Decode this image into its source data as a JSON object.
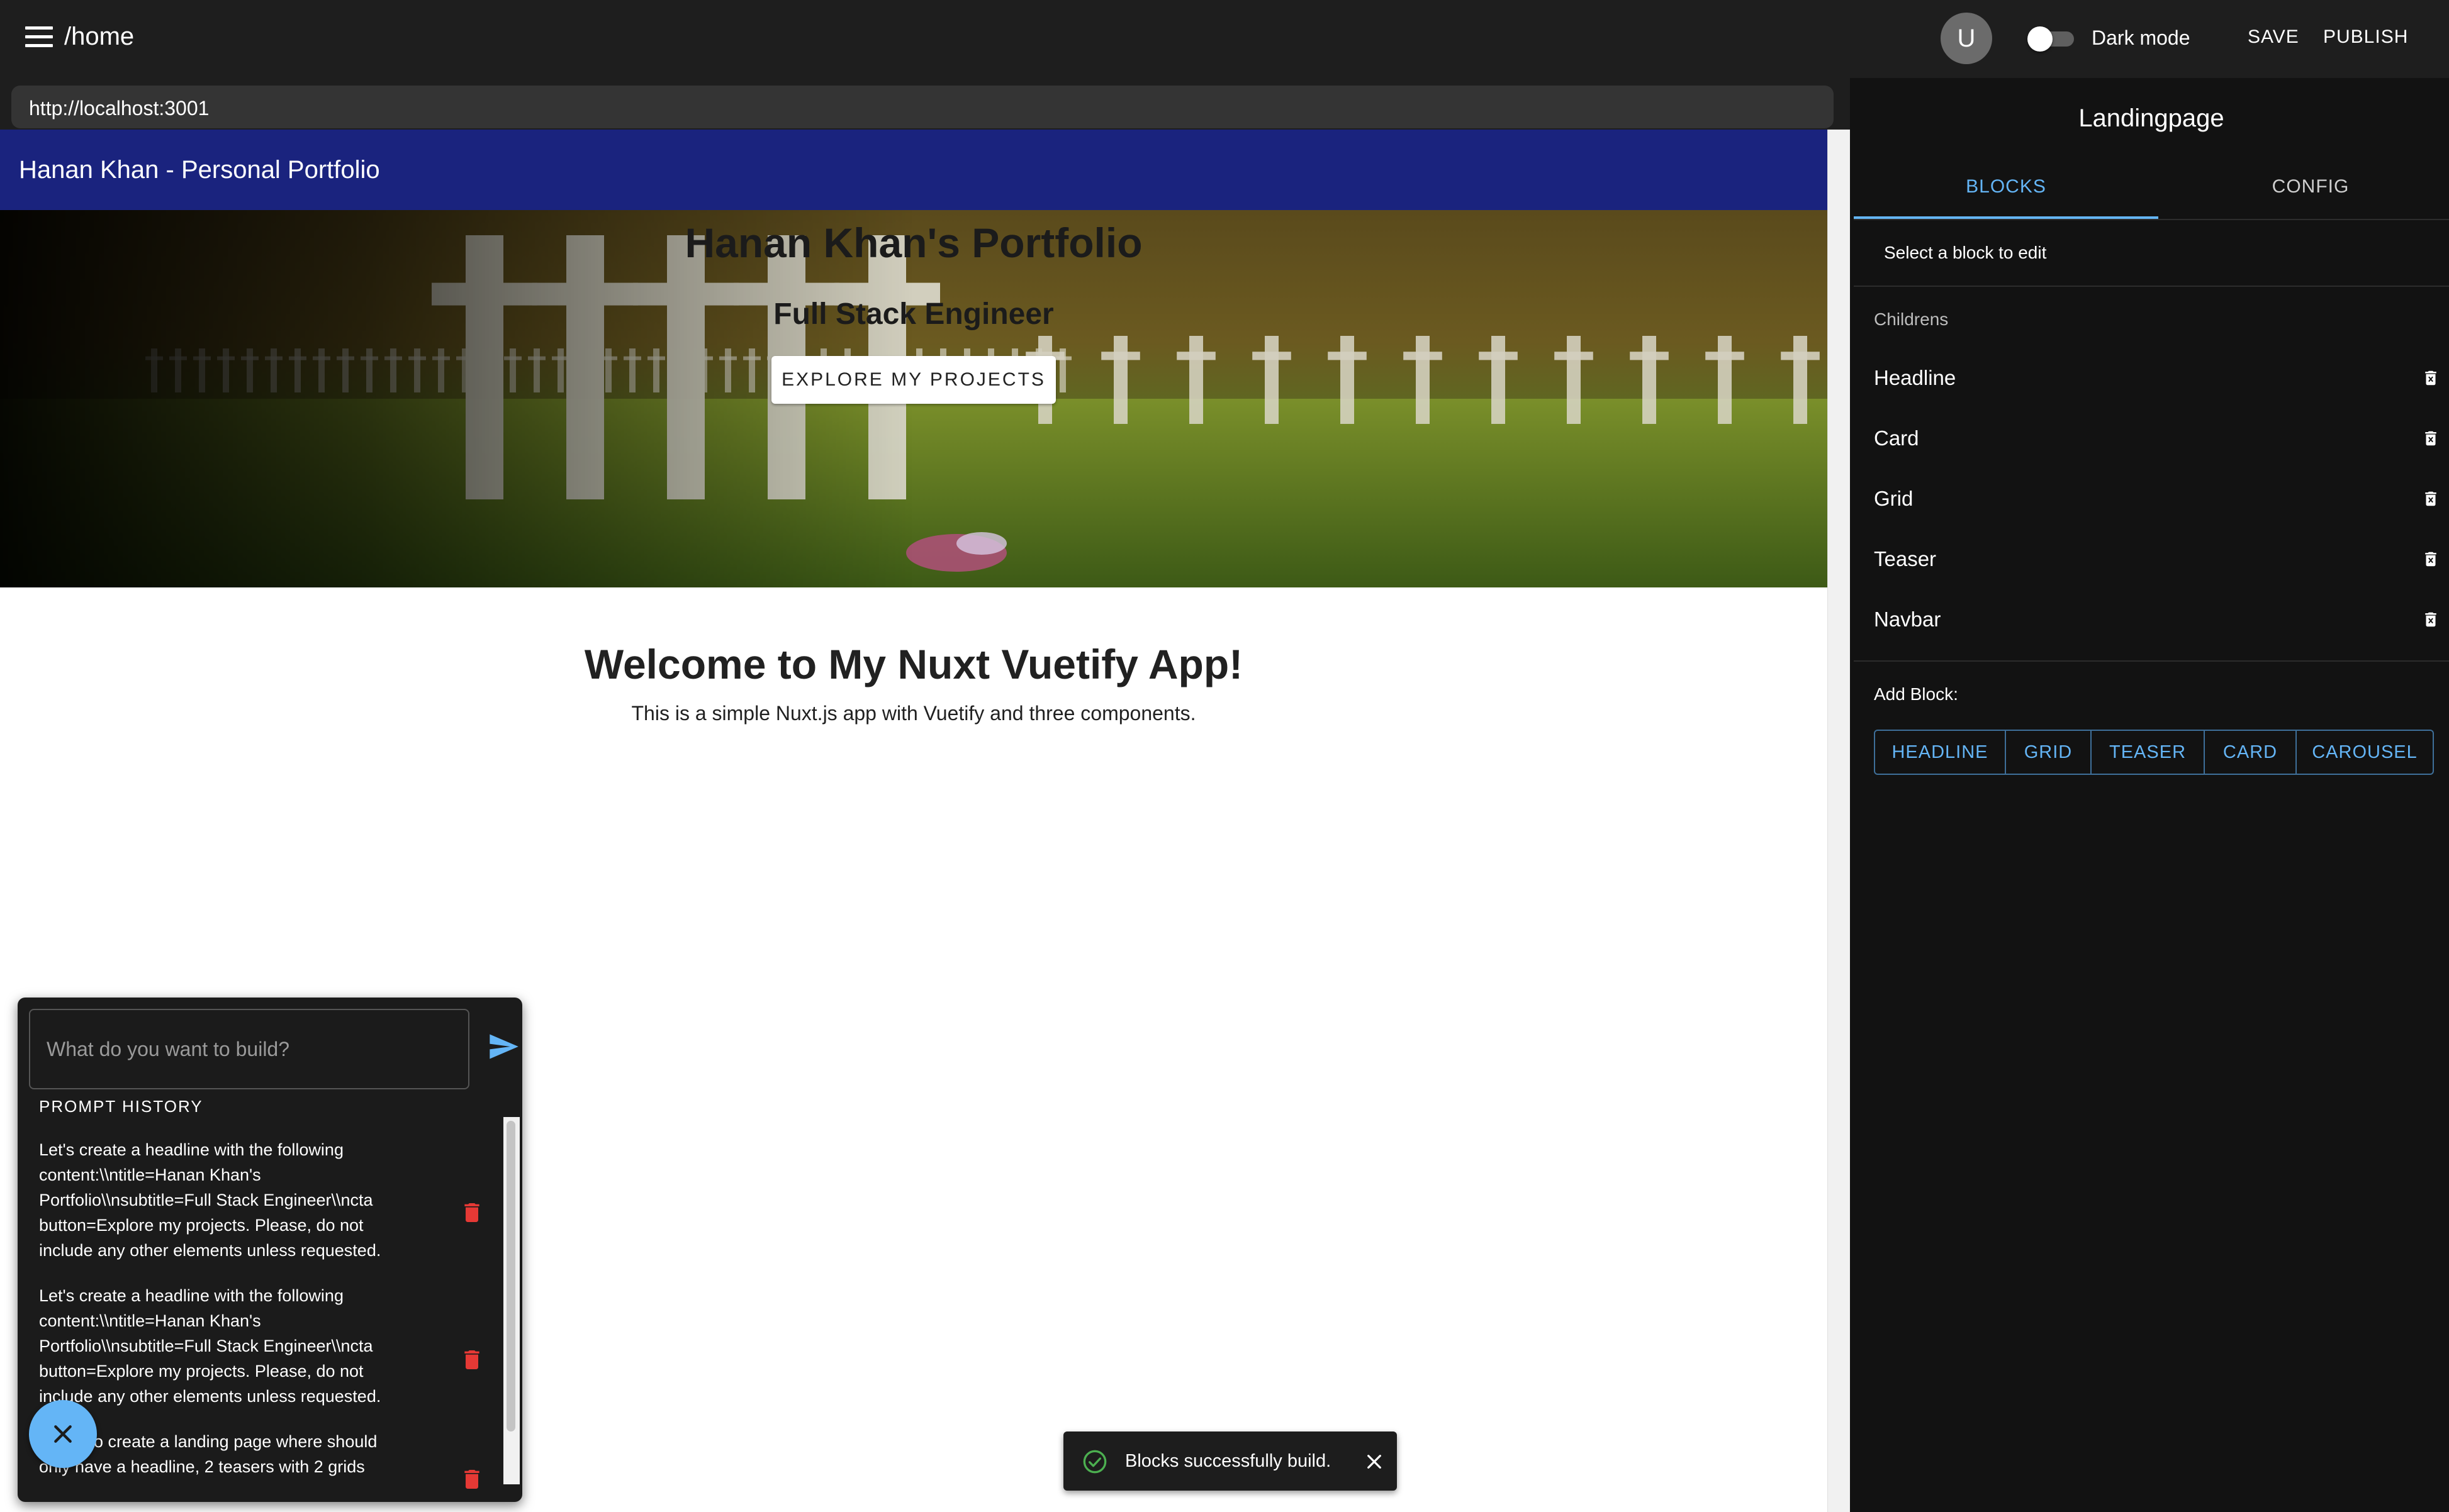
{
  "appbar": {
    "path": "/home",
    "avatar_letter": "U",
    "dark_mode_label": "Dark mode",
    "save_label": "SAVE",
    "publish_label": "PUBLISH"
  },
  "preview": {
    "url": "http://localhost:3001",
    "site_title": "Hanan Khan - Personal Portfolio",
    "hero": {
      "title": "Hanan Khan's Portfolio",
      "subtitle": "Full Stack Engineer",
      "cta": "EXPLORE MY PROJECTS"
    },
    "welcome": {
      "title": "Welcome to My Nuxt Vuetify App!",
      "text": "This is a simple Nuxt.js app with Vuetify and three components."
    }
  },
  "prompt": {
    "placeholder": "What do you want to build?",
    "history_label": "PROMPT HISTORY",
    "history": [
      {
        "lines": [
          "Let's create a headline with the following",
          "content:\\\\ntitle=Hanan Khan's",
          "Portfolio\\\\nsubtitle=Full Stack Engineer\\\\ncta",
          "button=Explore my projects. Please, do not",
          "include any other elements unless requested."
        ]
      },
      {
        "lines": [
          "Let's create a headline with the following",
          "content:\\\\ntitle=Hanan Khan's",
          "Portfolio\\\\nsubtitle=Full Stack Engineer\\\\ncta",
          "button=Explore my projects. Please, do not",
          "include any other elements unless requested."
        ]
      },
      {
        "lines": [
          "I want to create a landing page where should",
          "only have a headline, 2 teasers with 2 grids"
        ]
      }
    ]
  },
  "snackbar": {
    "message": "Blocks successfully build."
  },
  "editor": {
    "title": "Landingpage",
    "tabs": [
      "BLOCKS",
      "CONFIG"
    ],
    "select_hint": "Select a block to edit",
    "children_label": "Childrens",
    "children": [
      "Headline",
      "Card",
      "Grid",
      "Teaser",
      "Navbar"
    ],
    "add_block_label": "Add Block:",
    "add_buttons": [
      "HEADLINE",
      "GRID",
      "TEASER",
      "CARD",
      "CAROUSEL"
    ]
  },
  "colors": {
    "accent": "#64b5f6",
    "site_nav": "#1a237e",
    "danger": "#e53935",
    "success": "#4caf50"
  }
}
